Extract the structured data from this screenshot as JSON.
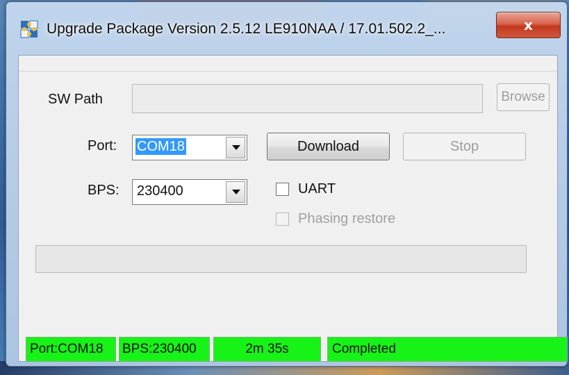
{
  "window": {
    "title": "Upgrade Package Version 2.5.12  LE910NAA / 17.01.502.2_...",
    "close_label": "x",
    "app_icon": "puzzle-app-icon"
  },
  "form": {
    "sw_path_label": "SW Path",
    "sw_path_value": "",
    "browse_label": "Browse",
    "port_label": "Port:",
    "port_value": "COM18",
    "download_label": "Download",
    "stop_label": "Stop",
    "bps_label": "BPS:",
    "bps_value": "230400",
    "uart_label": "UART",
    "uart_checked": false,
    "phasing_label": "Phasing restore",
    "phasing_checked": false
  },
  "progress": {
    "value": 0
  },
  "statusbar": {
    "port": "Port:COM18",
    "bps": "BPS:230400",
    "time": "2m 35s",
    "state": "Completed",
    "color": "#17f317"
  }
}
